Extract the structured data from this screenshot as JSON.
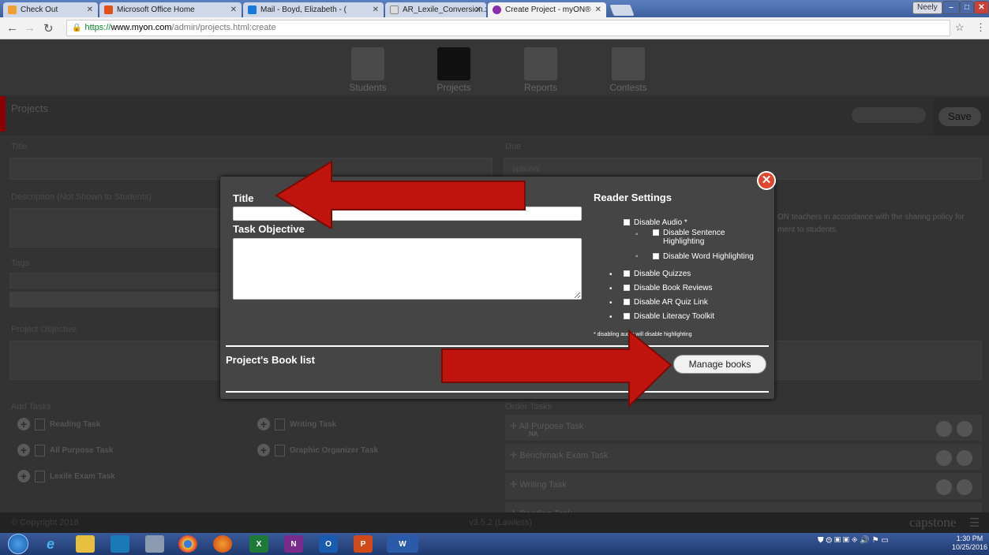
{
  "browser": {
    "tabs": [
      {
        "label": "Check Out",
        "icon_color": "#f0a030"
      },
      {
        "label": "Microsoft Office Home",
        "icon_color": "#e0501a"
      },
      {
        "label": "Mail - Boyd, Elizabeth - (",
        "icon_color": "#1a7ad8"
      },
      {
        "label": "AR_Lexile_Conversion.xls",
        "icon_color": "#aaaaaa"
      },
      {
        "label": "Create Project - myON®",
        "icon_color": "#8a2bb0"
      }
    ],
    "profile": "Neely",
    "url_scheme": "https://",
    "url_host": "www.myon.com",
    "url_path": "/admin/projects.html:create"
  },
  "app": {
    "nav": [
      "Students",
      "Projects",
      "Reports",
      "Contests"
    ],
    "page_title": "Projects",
    "save_label": "Save",
    "title_label": "Title",
    "due_label": "Due",
    "due_placeholder": "optional",
    "description_label": "Description (Not Shown to Students)",
    "sharing_text_1": "ON teachers in accordance with the sharing policy for",
    "sharing_text_2": "ment to students.",
    "tags_label": "Tags",
    "project_objective_label": "Project Objective",
    "add_tasks_label": "Add Tasks",
    "order_tasks_label": "Order Tasks",
    "add_tasks": [
      {
        "label": "Reading Task"
      },
      {
        "label": "All Purpose Task"
      },
      {
        "label": "Lexile Exam Task"
      },
      {
        "label": "Writing Task"
      },
      {
        "label": "Graphic Organizer Task"
      }
    ],
    "order_tasks": [
      {
        "label": "All Purpose Task",
        "sub": "NA"
      },
      {
        "label": "Benchmark Exam Task",
        "sub": ""
      },
      {
        "label": "Writing Task",
        "sub": ""
      },
      {
        "label": "Reading Task",
        "sub": ""
      }
    ],
    "footer_copyright": "© Copyright 2016",
    "footer_version": "v3.5.2 (Lawless)",
    "footer_brand": "capstone"
  },
  "modal": {
    "close_label": "✕",
    "title_label": "Title",
    "task_objective_label": "Task Objective",
    "reader_settings_label": "Reader Settings",
    "settings": {
      "disable_audio": "Disable Audio *",
      "disable_sentence": "Disable Sentence Highlighting",
      "disable_word": "Disable Word Highlighting",
      "disable_quizzes": "Disable Quizzes",
      "disable_book_reviews": "Disable Book Reviews",
      "disable_ar_quiz": "Disable AR Quiz Link",
      "disable_literacy": "Disable Literacy Toolkit"
    },
    "note": "* disabling audio will disable highlighting",
    "book_list_label": "Project's Book list",
    "manage_books_label": "Manage books"
  },
  "annotation_color": "#c0140e",
  "taskbar": {
    "time": "1:30 PM",
    "date": "10/25/2016"
  }
}
